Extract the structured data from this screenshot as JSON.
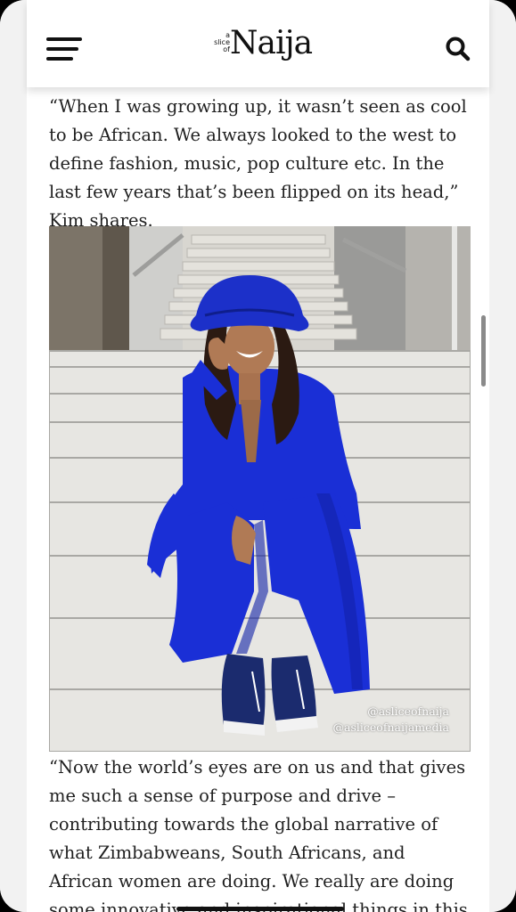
{
  "header": {
    "menu_icon": "hamburger-menu-icon",
    "logo_small_lines": [
      "a",
      "slice",
      "of"
    ],
    "logo_big": "Naija",
    "search_icon": "search-icon"
  },
  "article": {
    "paragraph_1": "“When I was growing up, it wasn’t seen as cool to be African. We always looked to the west to define fashion, music, pop culture etc. In the last few years that’s been flipped on its head,” Kim shares.",
    "photo_watermark_1": "@asliceofnaija",
    "photo_watermark_2": "@asliceofnaijamedia",
    "paragraph_2": "“Now the world’s eyes are on us and that gives me such a sense of purpose and drive – contributing towards the global narrative of what Zimbabweans, South Africans, and African women are doing. We really are doing some innovative and inspirational things in this world!”"
  },
  "colors": {
    "suit_blue": "#1a2fd6",
    "text": "#1f1f1f",
    "background": "#ffffff"
  }
}
